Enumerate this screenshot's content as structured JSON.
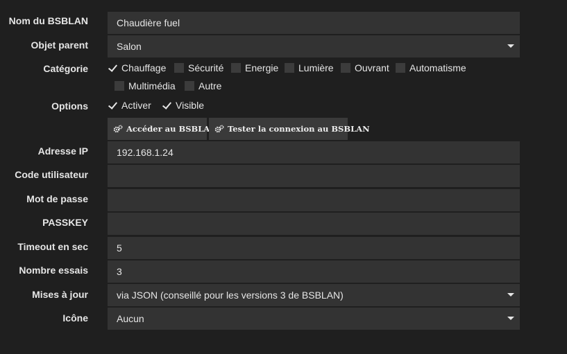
{
  "form": {
    "name": {
      "label": "Nom du BSBLAN",
      "value": "Chaudière fuel"
    },
    "parent": {
      "label": "Objet parent",
      "value": "Salon"
    },
    "category": {
      "label": "Catégorie",
      "items": [
        {
          "label": "Chauffage",
          "checked": true
        },
        {
          "label": "Sécurité",
          "checked": false
        },
        {
          "label": "Energie",
          "checked": false
        },
        {
          "label": "Lumière",
          "checked": false
        },
        {
          "label": "Ouvrant",
          "checked": false
        },
        {
          "label": "Automatisme",
          "checked": false
        },
        {
          "label": "Multimédia",
          "checked": false
        },
        {
          "label": "Autre",
          "checked": false
        }
      ]
    },
    "options": {
      "label": "Options",
      "items": [
        {
          "label": "Activer",
          "checked": true
        },
        {
          "label": "Visible",
          "checked": true
        }
      ]
    },
    "buttons": {
      "access": "Accéder au BSBLAN",
      "test": "Tester la connexion au BSBLAN",
      "icon": "cogs-icon"
    },
    "ip": {
      "label": "Adresse IP",
      "value": "192.168.1.24"
    },
    "user": {
      "label": "Code utilisateur",
      "value": ""
    },
    "password": {
      "label": "Mot de passe",
      "value": ""
    },
    "passkey": {
      "label": "PASSKEY",
      "value": ""
    },
    "timeout": {
      "label": "Timeout en sec",
      "value": "5"
    },
    "retries": {
      "label": "Nombre essais",
      "value": "3"
    },
    "updates": {
      "label": "Mises à jour",
      "value": "via JSON (conseillé pour les versions 3 de BSBLAN)"
    },
    "icon": {
      "label": "Icône",
      "value": "Aucun"
    }
  },
  "colors": {
    "background": "#1f1f1f",
    "field": "#333333",
    "button": "#3a3a3a",
    "text": "#e6e6e6"
  }
}
